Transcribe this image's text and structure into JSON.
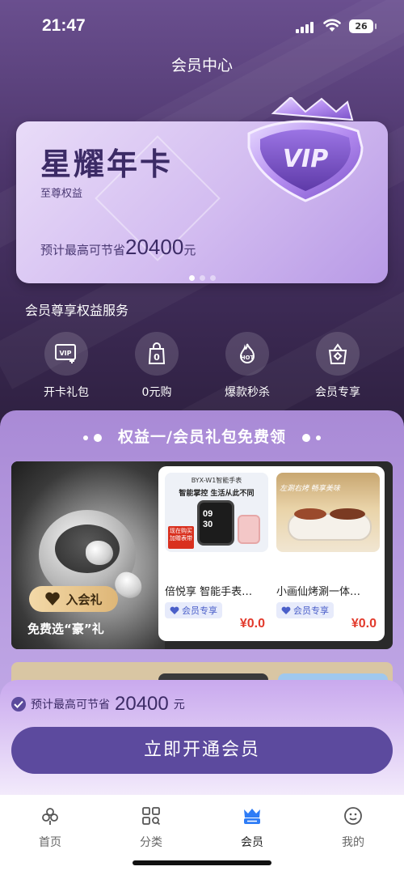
{
  "status_bar": {
    "time": "21:47",
    "battery": "26"
  },
  "header": {
    "title": "会员中心"
  },
  "card": {
    "title": "星耀年卡",
    "subtitle": "至尊权益",
    "save_prefix": "预计最高可节省",
    "save_amount": "20400",
    "save_unit": "元",
    "badge_text": "VIP",
    "slides": 3,
    "active_slide": 1
  },
  "benefits": {
    "title": "会员尊享权益服务",
    "items": [
      {
        "label": "开卡礼包",
        "icon": "vip-gift-icon"
      },
      {
        "label": "0元购",
        "icon": "zero-bag-icon"
      },
      {
        "label": "爆款秒杀",
        "icon": "hot-flame-icon"
      },
      {
        "label": "会员专享",
        "icon": "member-bag-icon"
      }
    ]
  },
  "gift_section": {
    "title": "权益一/会员礼包免费领",
    "hero": {
      "pill": "入会礼",
      "caption": "免费选“豪”礼"
    },
    "products": [
      {
        "name": "倍悦享 智能手表…",
        "tag": "会员专享",
        "price": "¥0.0",
        "img_header": "BYX-W1智能手表",
        "img_slogan": "智能掌控 生活从此不同",
        "img_badge": "现在购买加赠表带",
        "watch_time": "09 30"
      },
      {
        "name": "小画仙烤涮一体…",
        "tag": "会员专享",
        "price": "¥0.0",
        "img_slogan": "左涮右烤 畅享美味"
      }
    ]
  },
  "cta": {
    "save_prefix": "预计最高可节省",
    "save_amount": "20400",
    "save_unit": "元",
    "button": "立即开通会员"
  },
  "tabbar": {
    "items": [
      {
        "label": "首页",
        "icon": "home-flower-icon"
      },
      {
        "label": "分类",
        "icon": "category-grid-icon"
      },
      {
        "label": "会员",
        "icon": "member-crown-icon",
        "active": true
      },
      {
        "label": "我的",
        "icon": "profile-face-icon"
      }
    ]
  },
  "colors": {
    "accent": "#5c4a9e",
    "price": "#e23a2c",
    "tabActive": "#2e7cf6"
  }
}
